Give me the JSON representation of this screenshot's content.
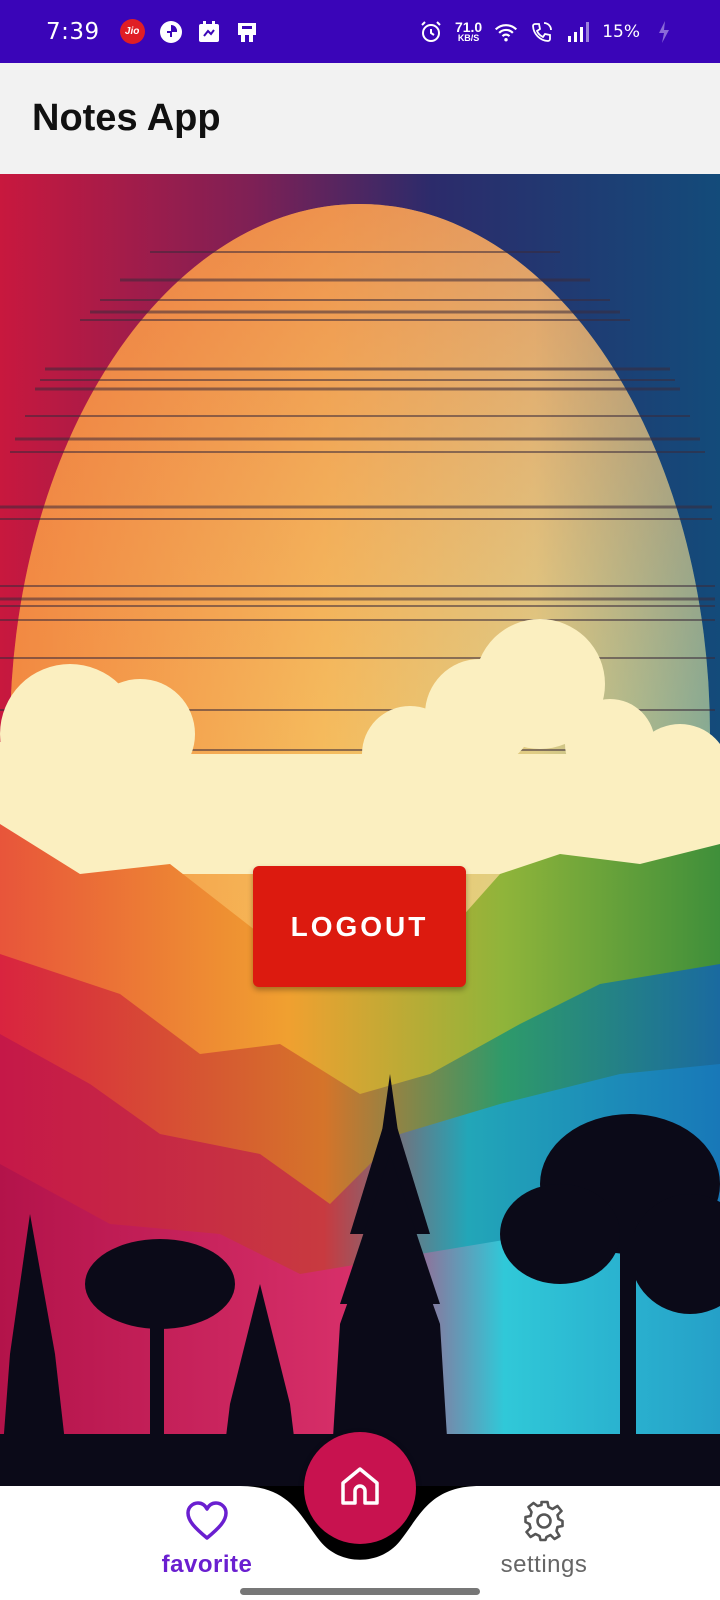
{
  "status_bar": {
    "time": "7:39",
    "carrier_badge": "Jio",
    "speed_value": "71.0",
    "speed_unit": "KB/S",
    "battery": "15%",
    "background": "#3a05b8"
  },
  "app_bar": {
    "title": "Notes App"
  },
  "main": {
    "logout_label": "LOGOUT",
    "logout_color": "#dc1a0f"
  },
  "bottom_nav": {
    "items": [
      {
        "label": "favorite",
        "icon": "heart-icon",
        "selected": true
      },
      {
        "label": "settings",
        "icon": "gear-icon",
        "selected": false
      }
    ],
    "fab_icon": "home-icon",
    "fab_color": "#c8124f",
    "selected_color": "#6a1fd0"
  }
}
